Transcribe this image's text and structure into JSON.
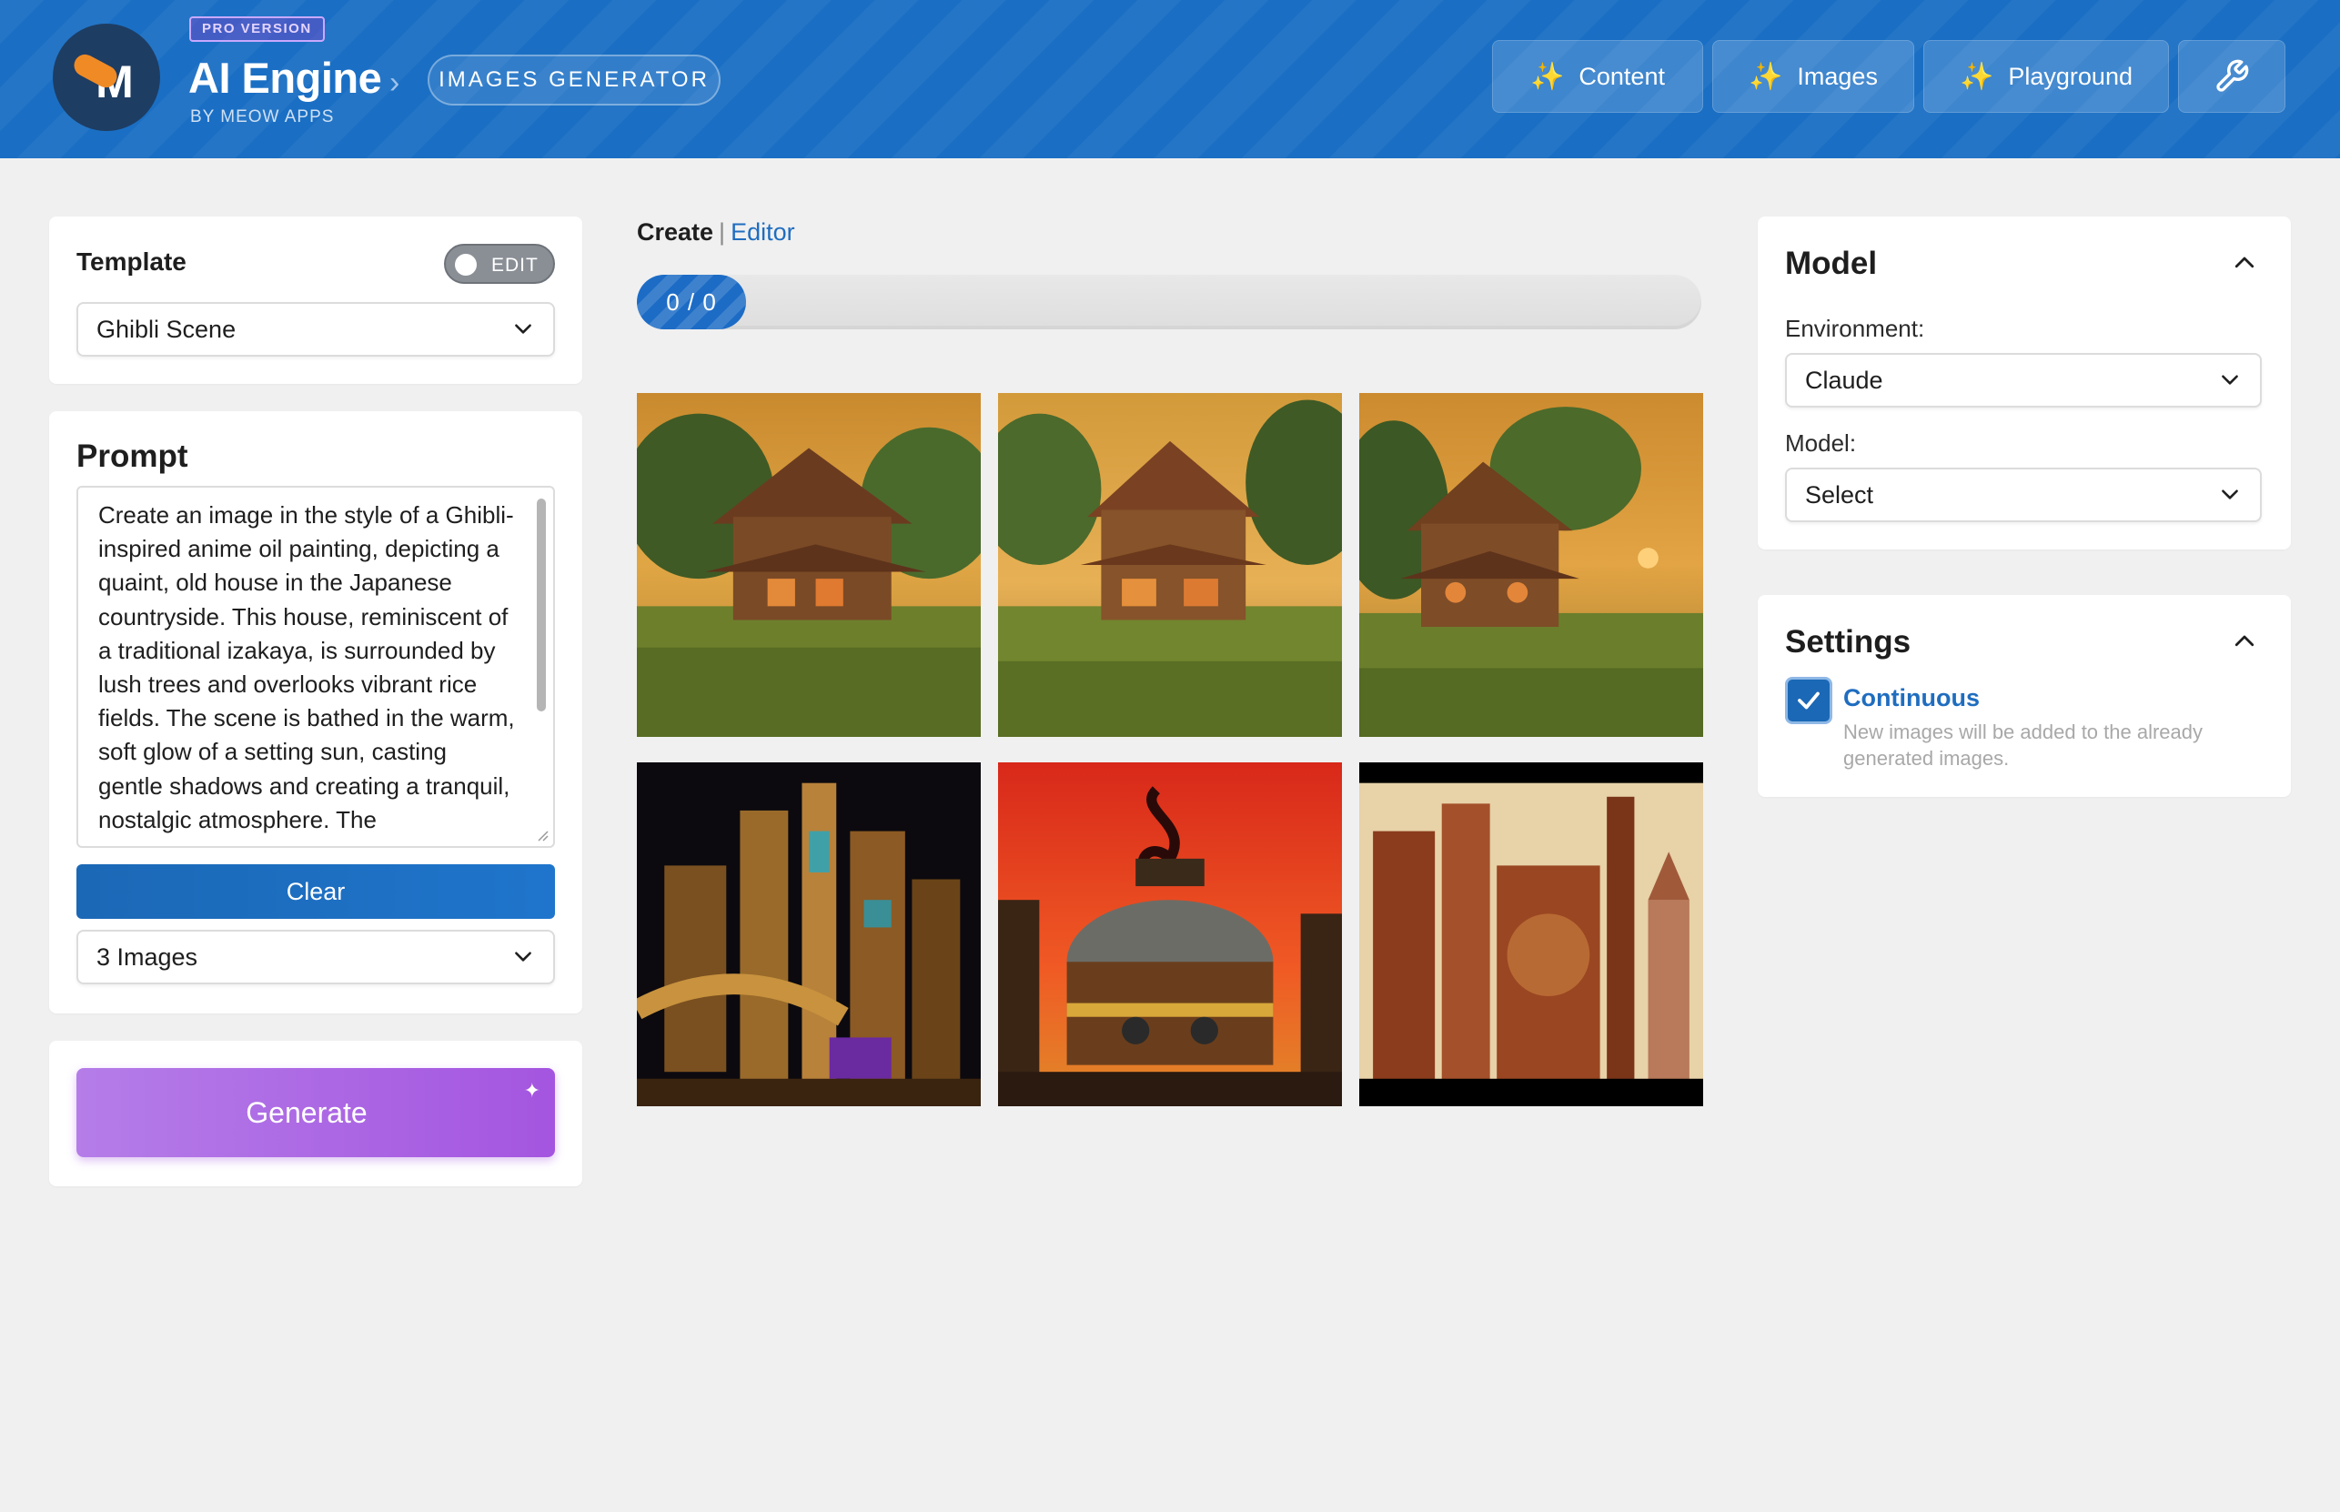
{
  "header": {
    "badge": "PRO VERSION",
    "title": "AI Engine",
    "subtitle": "BY MEOW APPS",
    "page": "IMAGES GENERATOR",
    "nav": [
      {
        "label": "Content",
        "icon": "magic-wand-icon"
      },
      {
        "label": "Images",
        "icon": "magic-wand-icon"
      },
      {
        "label": "Playground",
        "icon": "magic-wand-icon"
      }
    ],
    "settings_icon": "wrench-icon"
  },
  "left": {
    "template": {
      "label": "Template",
      "toggle_label": "EDIT",
      "toggle_on": false,
      "value": "Ghibli Scene"
    },
    "prompt": {
      "label": "Prompt",
      "text": "Create an image in the style of a Ghibli-inspired anime oil painting, depicting a quaint, old house in the Japanese countryside. This house, reminiscent of a traditional izakaya, is surrounded by lush trees and overlooks vibrant rice fields. The scene is bathed in the warm, soft glow of a setting sun, casting gentle shadows and creating a tranquil, nostalgic atmosphere. The"
    },
    "clear_label": "Clear",
    "count_value": "3 Images",
    "generate_label": "Generate"
  },
  "center": {
    "tab_create": "Create",
    "tab_separator": "|",
    "tab_editor": "Editor",
    "progress": {
      "text": "0 / 0",
      "value": 0
    },
    "images": [
      {
        "subject": "ghibli-house-sunset"
      },
      {
        "subject": "ghibli-house-sunset"
      },
      {
        "subject": "ghibli-house-sunset"
      },
      {
        "subject": "steampunk-city-night"
      },
      {
        "subject": "steampunk-dome-red-sky"
      },
      {
        "subject": "steampunk-palace"
      }
    ]
  },
  "right": {
    "model": {
      "title": "Model",
      "environment_label": "Environment:",
      "environment_value": "Claude",
      "model_label": "Model:",
      "model_value": "Select"
    },
    "settings": {
      "title": "Settings",
      "continuous_label": "Continuous",
      "continuous_checked": true,
      "continuous_desc": "New images will be added to the already generated images."
    }
  },
  "colors": {
    "header_blue": "#1a6fc4",
    "primary": "#1b68b6",
    "generate": "#a455e0",
    "link": "#1f6dbf"
  }
}
